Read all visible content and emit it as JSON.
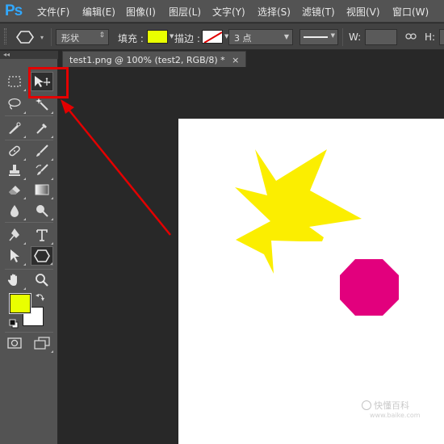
{
  "app": {
    "logo": "Ps"
  },
  "menu": {
    "items": [
      "文件(F)",
      "编辑(E)",
      "图像(I)",
      "图层(L)",
      "文字(Y)",
      "选择(S)",
      "滤镜(T)",
      "视图(V)",
      "窗口(W)"
    ]
  },
  "options": {
    "mode_value": "形状",
    "fill_label": "填充 :",
    "fill_color": "#e9ff00",
    "stroke_label": "描边 :",
    "stroke_width_value": "3 点",
    "w_label": "W:",
    "h_label": "H:"
  },
  "toolbox": {
    "collapse": "◂◂",
    "foreground_color": "#e9ff00",
    "background_color": "#ffffff",
    "active_tool": "move-tool",
    "selected_tool": "polygon-tool"
  },
  "document": {
    "tab_title": "test1.png @ 100% (test2, RGB/8) *",
    "close": "×",
    "shapes": [
      {
        "kind": "star",
        "color": "#fbee00"
      },
      {
        "kind": "octagon",
        "color": "#e2007d"
      }
    ]
  },
  "annotation": {
    "color": "#e30000"
  },
  "watermark": {
    "text": "快懂百科",
    "url": "www.baike.com"
  }
}
